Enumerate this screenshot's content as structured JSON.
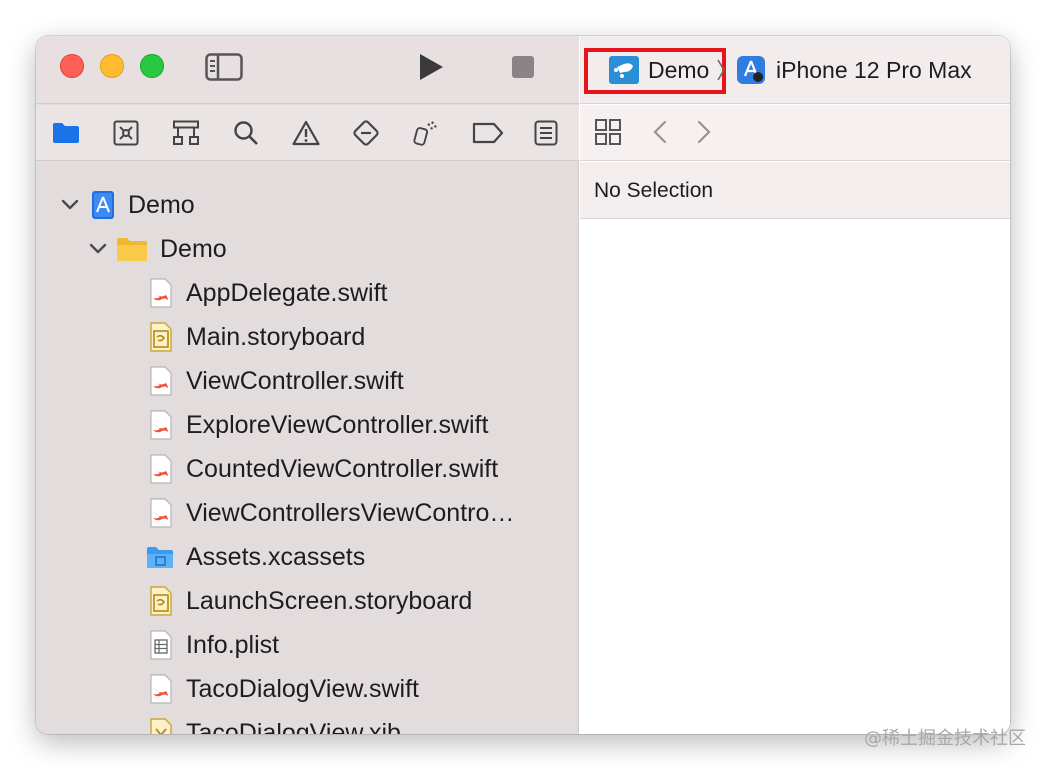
{
  "toolbar": {
    "scheme_name": "Demo",
    "device_name": "iPhone 12 Pro Max",
    "run_icon": "play-icon",
    "stop_icon": "stop-icon",
    "sidebar_toggle_icon": "sidebar-toggle-icon"
  },
  "navigator_tabs": [
    {
      "name": "project-navigator-icon",
      "active": true
    },
    {
      "name": "source-control-icon",
      "active": false
    },
    {
      "name": "symbol-navigator-icon",
      "active": false
    },
    {
      "name": "find-navigator-icon",
      "active": false
    },
    {
      "name": "issue-navigator-icon",
      "active": false
    },
    {
      "name": "test-navigator-icon",
      "active": false
    },
    {
      "name": "debug-navigator-icon",
      "active": false
    },
    {
      "name": "breakpoint-navigator-icon",
      "active": false
    },
    {
      "name": "report-navigator-icon",
      "active": false
    }
  ],
  "tree": {
    "project": "Demo",
    "group": "Demo",
    "files": [
      {
        "label": "AppDelegate.swift",
        "type": "swift"
      },
      {
        "label": "Main.storyboard",
        "type": "storyboard"
      },
      {
        "label": "ViewController.swift",
        "type": "swift"
      },
      {
        "label": "ExploreViewController.swift",
        "type": "swift"
      },
      {
        "label": "CountedViewController.swift",
        "type": "swift"
      },
      {
        "label": "ViewControllersViewContro…",
        "type": "swift"
      },
      {
        "label": "Assets.xcassets",
        "type": "assets"
      },
      {
        "label": "LaunchScreen.storyboard",
        "type": "storyboard"
      },
      {
        "label": "Info.plist",
        "type": "plist"
      },
      {
        "label": "TacoDialogView.swift",
        "type": "swift"
      },
      {
        "label": "TacoDialogView.xib",
        "type": "xib"
      }
    ]
  },
  "editor": {
    "no_selection": "No Selection"
  },
  "watermark": "@稀土掘金技术社区",
  "colors": {
    "highlight_border": "#e8141c",
    "active_tab": "#1a73e8",
    "swift": "#f05138",
    "folder": "#f9c94a"
  }
}
